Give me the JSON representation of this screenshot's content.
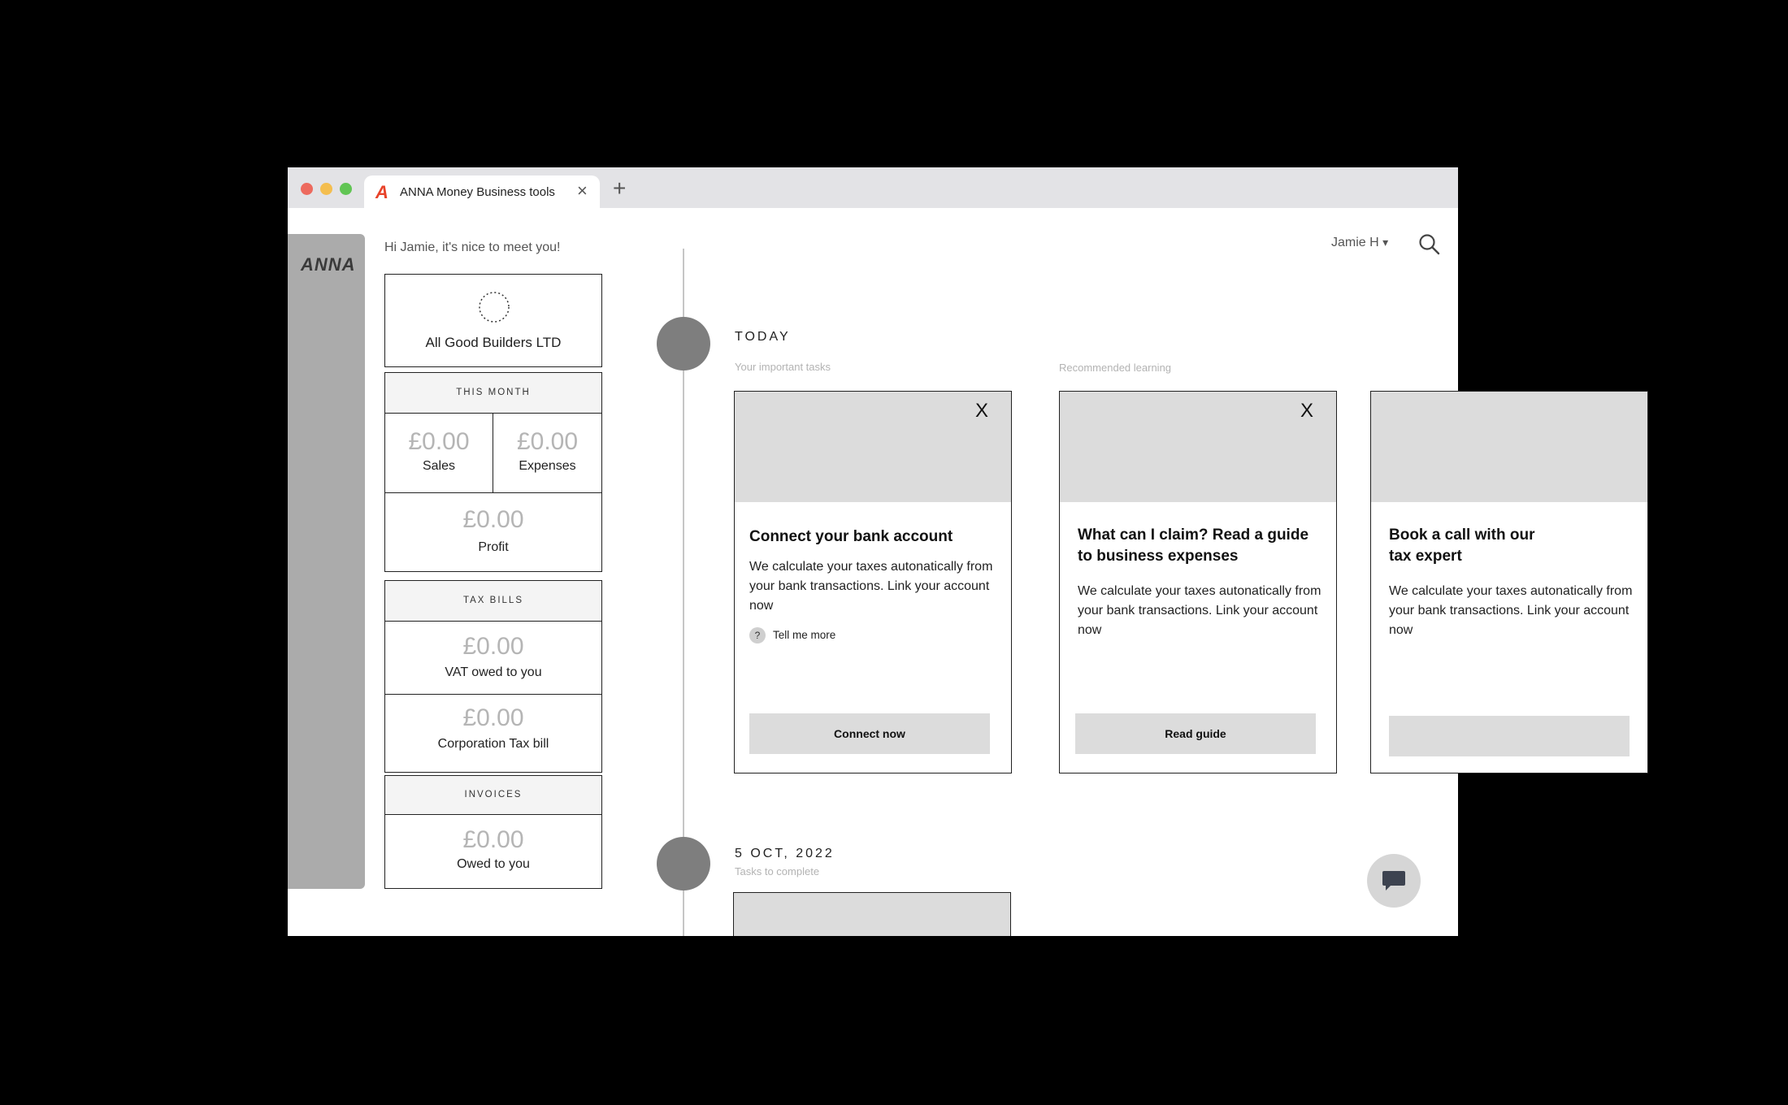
{
  "browser": {
    "tab_logo": "A",
    "tab_title": "ANNA Money Business tools",
    "tab_close": "×",
    "new_tab": "+"
  },
  "rail": {
    "logo": "ANNA"
  },
  "header": {
    "greeting": "Hi Jamie, it's nice to meet you!",
    "user_menu": "Jamie H",
    "user_caret": "▾"
  },
  "company": {
    "name": "All Good Builders LTD"
  },
  "this_month": {
    "heading": "THIS MONTH",
    "sales_amount": "£0.00",
    "sales_label": "Sales",
    "expenses_amount": "£0.00",
    "expenses_label": "Expenses",
    "profit_amount": "£0.00",
    "profit_label": "Profit"
  },
  "tax_bills": {
    "heading": "TAX BILLS",
    "vat_amount": "£0.00",
    "vat_label": "VAT owed to you",
    "corp_amount": "£0.00",
    "corp_label": "Corporation Tax bill"
  },
  "invoices": {
    "heading": "INVOICES",
    "owed_amount": "£0.00",
    "owed_label": "Owed to you"
  },
  "timeline": {
    "today": {
      "date": "TODAY",
      "tasks_label": "Your important tasks",
      "learning_label": "Recommended learning"
    },
    "oct": {
      "date": "5 OCT, 2022",
      "sub": "Tasks to complete"
    }
  },
  "cards": [
    {
      "close": "X",
      "title": "Connect your bank account",
      "body": "We calculate your taxes autonatically from your bank transactions. Link your account now",
      "help_icon": "?",
      "help_text": "Tell me more",
      "button": "Connect now"
    },
    {
      "close": "X",
      "title": "What can I claim? Read a guide to business expenses",
      "body": "We calculate your taxes autonatically from your bank transactions. Link your account now",
      "button": "Read guide"
    },
    {
      "title": "Book a call with our tax expert",
      "body": "We calculate your taxes autonatically from your bank transactions. Link your account now",
      "button": ""
    }
  ],
  "icons": {
    "search": "search-icon",
    "chat": "chat-icon",
    "avatar_placeholder": "avatar-placeholder-icon"
  }
}
